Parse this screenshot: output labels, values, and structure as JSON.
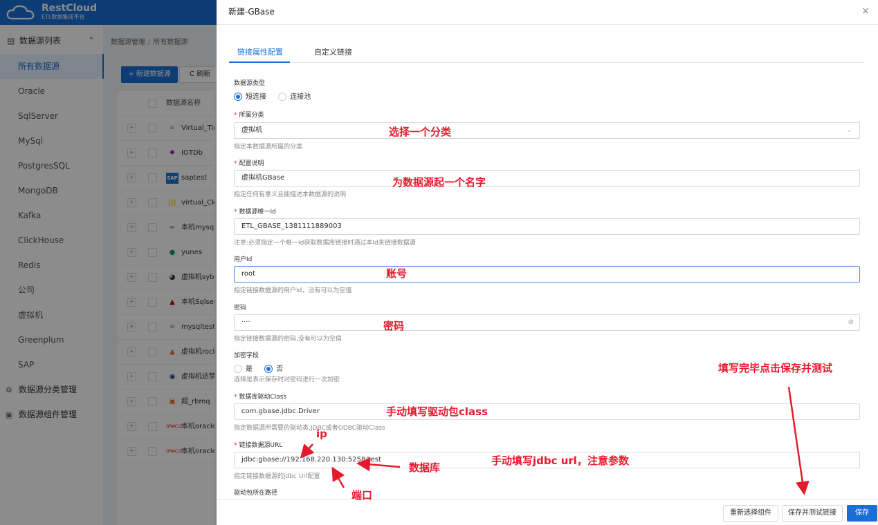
{
  "app": {
    "brand": "RestCloud",
    "brand_sub": "ETL数据集成平台"
  },
  "sidebar": {
    "group_label": "数据源列表",
    "items": [
      {
        "label": "所有数据源"
      },
      {
        "label": "Oracle"
      },
      {
        "label": "SqlServer"
      },
      {
        "label": "MySql"
      },
      {
        "label": "PostgresSQL"
      },
      {
        "label": "MongoDB"
      },
      {
        "label": "Kafka"
      },
      {
        "label": "ClickHouse"
      },
      {
        "label": "Redis"
      },
      {
        "label": "公司"
      },
      {
        "label": "虚拟机"
      },
      {
        "label": "Greenplum"
      },
      {
        "label": "SAP"
      }
    ],
    "category_mgmt": "数据源分类管理",
    "component_mgmt": "数据源组件管理"
  },
  "content": {
    "breadcrumb": [
      "数据源管理",
      "所有数据源"
    ],
    "new_button": "+ 新建数据源",
    "refresh_button": "C 刷新",
    "table_header": "数据源名称",
    "rows": [
      {
        "name": "Virtual_Tidb"
      },
      {
        "name": "IOTDb"
      },
      {
        "name": "saptest"
      },
      {
        "name": "virtual_Ckhouse"
      },
      {
        "name": "本机mysql"
      },
      {
        "name": "yunes"
      },
      {
        "name": "虚拟机sybase"
      },
      {
        "name": "本机Sqlserver"
      },
      {
        "name": "mysqltest"
      },
      {
        "name": "虚拟机rocketmq"
      },
      {
        "name": "虚拟机达梦"
      },
      {
        "name": "超_rbmq"
      },
      {
        "name": "本机oracle"
      },
      {
        "name": "本机oracleP"
      }
    ]
  },
  "drawer": {
    "title": "新建-GBase",
    "close": "×",
    "tabs": [
      {
        "label": "链接属性配置"
      },
      {
        "label": "自定义链接"
      }
    ],
    "fields": {
      "ds_type_label": "数据源类型",
      "ds_type_options": [
        "短连接",
        "连接池"
      ],
      "category_label": "所属分类",
      "category_value": "虚拟机",
      "category_hint": "指定本数据源所属的分类",
      "config_label": "配置说明",
      "config_value": "虚拟机GBase",
      "config_hint": "指定任何有意义且能描述本数据源的说明",
      "unique_id_label": "数据源唯一Id",
      "unique_id_value": "ETL_GBASE_1381111889003",
      "unique_id_hint": "注意:必须指定一个唯一Id获取数据库链接时通过本Id来链接数据源",
      "user_label": "用户Id",
      "user_value": "root",
      "user_hint": "指定链接数据源的用户Id，没有可以为空值",
      "password_label": "密码",
      "password_value": "····",
      "password_hint": "指定链接数据源的密码,没有可以为空值",
      "encrypt_label": "加密字段",
      "encrypt_options": [
        "是",
        "否"
      ],
      "encrypt_hint": "选择是表示保存时对密码进行一次加密",
      "driver_label": "数据库驱动Class",
      "driver_value": "com.gbase.jdbc.Driver",
      "driver_hint": "指定数据源所需要的驱动类,JDBC或者ODBC驱动Class",
      "url_label": "链接数据源URL",
      "url_value": "jdbc:gbase://192.168.220.130:5258/test",
      "url_hint": "指定链接数据源的jdbc Url配置",
      "driver_path_label": "驱动包所在路径"
    },
    "footer": {
      "reselect": "重新选择组件",
      "save_test": "保存并测试链接",
      "save": "保存"
    }
  },
  "annotations": {
    "category": "选择一个分类",
    "name": "为数据源起一个名字",
    "account": "账号",
    "password": "密码",
    "save_test": "填写完毕点击保存并测试",
    "driver": "手动填写驱动包class",
    "ip": "ip",
    "url": "手动填写jdbc url，注意参数",
    "database": "数据库",
    "port": "端口"
  },
  "colors": {
    "primary": "#1a6fd6",
    "annotation": "#e8192c",
    "required": "#f5222d"
  }
}
